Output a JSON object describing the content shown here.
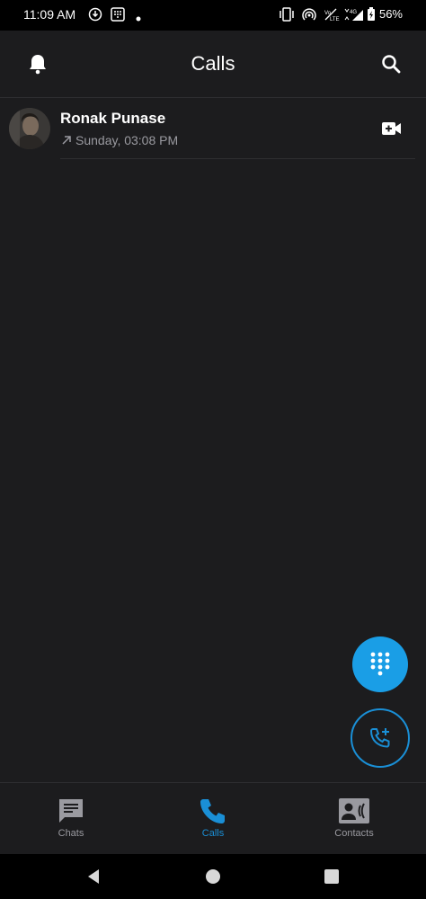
{
  "status_bar": {
    "time": "11:09 AM",
    "battery": "56%",
    "network": "4G"
  },
  "header": {
    "title": "Calls",
    "left_icon": "bell-icon",
    "right_icon": "search-icon"
  },
  "calls": [
    {
      "name": "Ronak Punase",
      "time": "Sunday, 03:08 PM",
      "direction": "outgoing",
      "action_icon": "video-call-icon"
    }
  ],
  "fabs": {
    "dialpad_icon": "dialpad-icon",
    "new_call_icon": "add-call-icon"
  },
  "bottom_nav": {
    "items": [
      {
        "label": "Chats",
        "icon": "chat-icon",
        "active": false
      },
      {
        "label": "Calls",
        "icon": "phone-icon",
        "active": true
      },
      {
        "label": "Contacts",
        "icon": "contacts-icon",
        "active": false
      }
    ]
  },
  "colors": {
    "background": "#1c1c1e",
    "accent": "#1a9ee6",
    "inactive": "#9a9aa0"
  }
}
